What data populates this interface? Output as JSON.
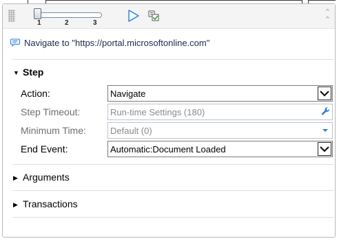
{
  "toolbar": {
    "slider_ticks": [
      "1",
      "2",
      "3"
    ],
    "slider_position": 1,
    "icons": [
      "grip-icon",
      "play-icon",
      "trace-icon",
      "collapse-up-icon"
    ]
  },
  "summary": {
    "text": "Navigate to \"https://portal.microsoftonline.com\""
  },
  "step": {
    "title": "Step",
    "fields": {
      "action": {
        "label": "Action:",
        "value": "Navigate"
      },
      "step_timeout": {
        "label": "Step Timeout:",
        "value": "Run-time Settings (180)"
      },
      "minimum_time": {
        "label": "Minimum Time:",
        "value": "Default (0)"
      },
      "end_event": {
        "label": "End Event:",
        "value": "Automatic:Document Loaded"
      }
    }
  },
  "sections": {
    "arguments": "Arguments",
    "transactions": "Transactions"
  },
  "colors": {
    "accent_blue": "#2f7fd4",
    "play_blue": "#3a8ee6",
    "trace_green": "#3ea64a"
  }
}
